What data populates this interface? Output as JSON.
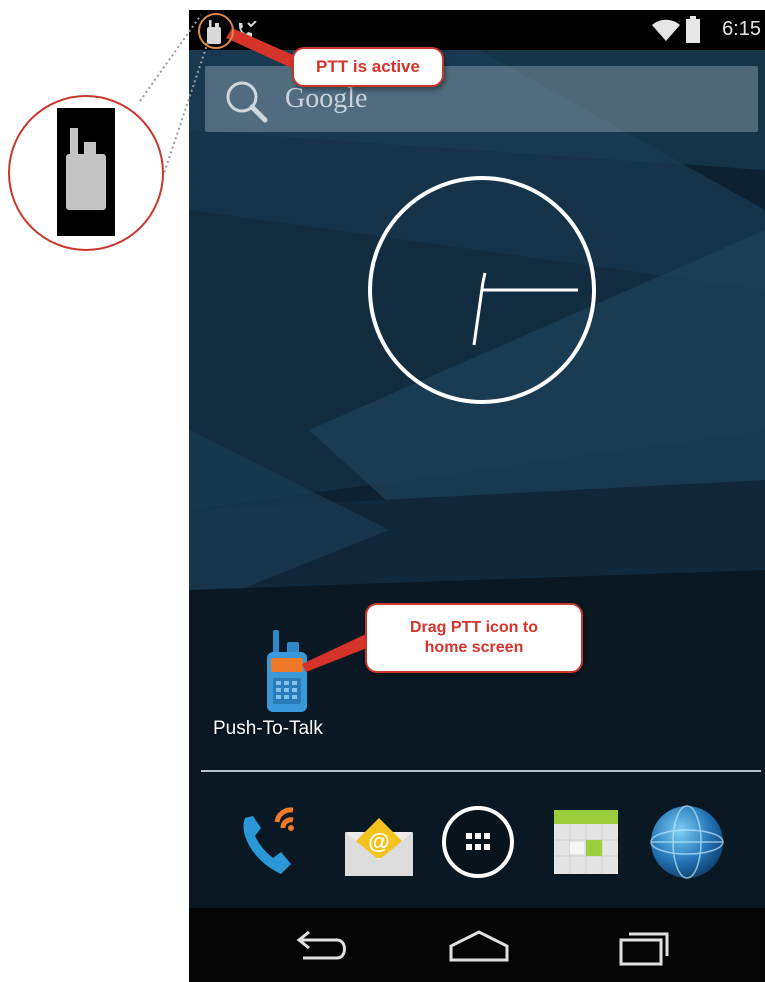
{
  "status_bar": {
    "time": "6:15",
    "icons": [
      "walkie-talkie-icon",
      "missed-call-icon",
      "wifi-icon",
      "battery-icon"
    ]
  },
  "search_bar": {
    "label": "Google",
    "icon": "magnifier-icon"
  },
  "clock_widget": {
    "type": "analog",
    "shows_time": "6:15"
  },
  "home_shortcut": {
    "label": "Push-To-Talk",
    "icon": "walkie-talkie-icon"
  },
  "dock": {
    "items": [
      "phone-icon",
      "email-icon",
      "app-drawer-icon",
      "calendar-icon",
      "browser-globe-icon"
    ]
  },
  "nav_bar": {
    "buttons": [
      "back-icon",
      "home-icon",
      "recent-apps-icon"
    ]
  },
  "annotations": {
    "ptt_active": "PTT is active",
    "drag_hint_line1": "Drag PTT icon to",
    "drag_hint_line2": "home screen"
  },
  "colors": {
    "callout_border": "#c9372c",
    "callout_text": "#d6332a",
    "ptt_icon_blue": "#3a9ad9",
    "ptt_icon_orange": "#f07a28"
  }
}
